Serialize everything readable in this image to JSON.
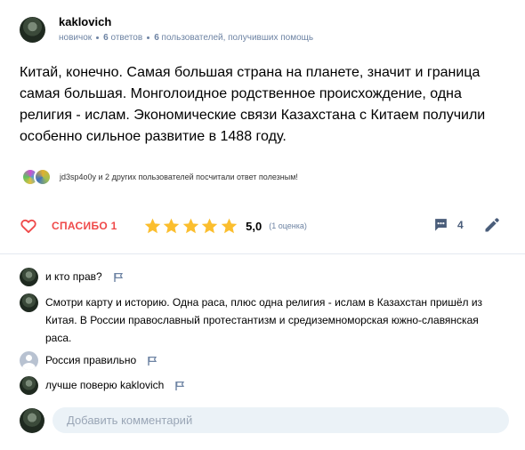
{
  "answer": {
    "author": "kaklovich",
    "rank": "новичок",
    "answers_count": "6",
    "answers_word": "ответов",
    "helped_count": "6",
    "helped_text": "пользователей, получивших помощь",
    "body": "Китай, конечно. Самая большая страна на планете, значит и граница самая большая. Монголоидное родственное происхождение, одна религия - ислам. Экономические связи Казахстана с Китаем получили особенно сильное развитие в 1488 году.",
    "thanked_text": "jd3sp4o0y и 2 других пользователей посчитали ответ полезным!"
  },
  "actions": {
    "thanks_label": "СПАСИБО 1",
    "rating_value": "5,0",
    "rating_count": "(1 оценка)",
    "rating_stars": 5,
    "comments_count": "4",
    "heart_color": "#ef4a4a",
    "star_color": "#fbbe2e"
  },
  "comments": [
    {
      "text": "и кто прав?",
      "avatar": "user-photo"
    },
    {
      "text": "Смотри карту и историю. Одна раса, плюс одна религия - ислам в Казахстан пришёл из Китая. В России православный протестантизм и средиземноморская южно-славянская раса.",
      "avatar": "user-photo"
    },
    {
      "text": "Россия правильно",
      "avatar": "default"
    },
    {
      "text": "лучше поверю kaklovich",
      "avatar": "user-photo"
    }
  ],
  "add_comment": {
    "placeholder": "Добавить комментарий"
  }
}
